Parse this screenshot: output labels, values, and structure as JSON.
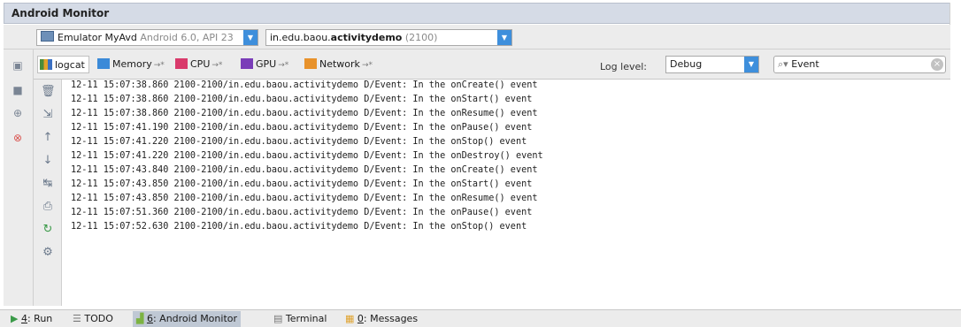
{
  "panel": {
    "title": "Android Monitor"
  },
  "devices": {
    "device_name": "Emulator MyAvd",
    "device_detail": "Android 6.0, API 23",
    "process_name_prefix": "in.edu.baou.",
    "process_name_bold": "activitydemo",
    "process_pid": "(2100)"
  },
  "tabs": [
    {
      "label": "logcat"
    },
    {
      "label": "Memory"
    },
    {
      "label": "CPU"
    },
    {
      "label": "GPU"
    },
    {
      "label": "Network"
    }
  ],
  "tab_arrow": "→*",
  "log_level": {
    "label": "Log level:",
    "value": "Debug"
  },
  "search": {
    "value": "Event"
  },
  "log_lines": [
    "12-11 15:07:38.860 2100-2100/in.edu.baou.activitydemo D/Event: In the onCreate() event",
    "12-11 15:07:38.860 2100-2100/in.edu.baou.activitydemo D/Event: In the onStart() event",
    "12-11 15:07:38.860 2100-2100/in.edu.baou.activitydemo D/Event: In the onResume() event",
    "12-11 15:07:41.190 2100-2100/in.edu.baou.activitydemo D/Event: In the onPause() event",
    "12-11 15:07:41.220 2100-2100/in.edu.baou.activitydemo D/Event: In the onStop() event",
    "12-11 15:07:41.220 2100-2100/in.edu.baou.activitydemo D/Event: In the onDestroy() event",
    "12-11 15:07:43.840 2100-2100/in.edu.baou.activitydemo D/Event: In the onCreate() event",
    "12-11 15:07:43.850 2100-2100/in.edu.baou.activitydemo D/Event: In the onStart() event",
    "12-11 15:07:43.850 2100-2100/in.edu.baou.activitydemo D/Event: In the onResume() event",
    "12-11 15:07:51.360 2100-2100/in.edu.baou.activitydemo D/Event: In the onPause() event",
    "12-11 15:07:52.630 2100-2100/in.edu.baou.activitydemo D/Event: In the onStop() event"
  ],
  "bottom_tabs": {
    "run_key": "4",
    "run_label": ": Run",
    "todo": "TODO",
    "monitor_key": "6",
    "monitor_label": ": Android Monitor",
    "terminal": "Terminal",
    "messages_key": "0",
    "messages_label": ": Messages"
  },
  "colors": {
    "accent": "#3e8fdc",
    "active_tab": "#bfc8d4",
    "error_icon": "#d9534f"
  }
}
